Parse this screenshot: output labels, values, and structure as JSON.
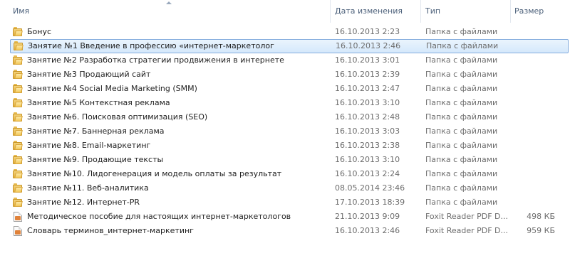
{
  "columns": {
    "name": "Имя",
    "date": "Дата изменения",
    "type": "Тип",
    "size": "Размер"
  },
  "colors": {
    "selection_border": "#84acdd",
    "selection_fill": "#d5e8fb",
    "header_text": "#4c607a"
  },
  "files": [
    {
      "icon": "folder-icon",
      "name": "Бонус",
      "date": "16.10.2013 2:23",
      "type": "Папка с файлами",
      "size": "",
      "selected": false
    },
    {
      "icon": "folder-icon",
      "name": "Занятие №1 Введение в профессию «интернет-маркетолог",
      "date": "16.10.2013 2:46",
      "type": "Папка с файлами",
      "size": "",
      "selected": true
    },
    {
      "icon": "folder-icon",
      "name": "Занятие №2 Разработка стратегии продвижения в интернете",
      "date": "16.10.2013 3:01",
      "type": "Папка с файлами",
      "size": "",
      "selected": false
    },
    {
      "icon": "folder-icon",
      "name": "Занятие №3 Продающий сайт",
      "date": "16.10.2013 2:39",
      "type": "Папка с файлами",
      "size": "",
      "selected": false
    },
    {
      "icon": "folder-icon",
      "name": "Занятие №4 Social Media Marketing (SMM)",
      "date": "16.10.2013 2:47",
      "type": "Папка с файлами",
      "size": "",
      "selected": false
    },
    {
      "icon": "folder-icon",
      "name": "Занятие №5 Контекстная реклама",
      "date": "16.10.2013 3:10",
      "type": "Папка с файлами",
      "size": "",
      "selected": false
    },
    {
      "icon": "folder-icon",
      "name": "Занятие №6. Поисковая оптимизация (SEO)",
      "date": "16.10.2013 2:48",
      "type": "Папка с файлами",
      "size": "",
      "selected": false
    },
    {
      "icon": "folder-icon",
      "name": "Занятие №7. Баннерная реклама",
      "date": "16.10.2013 3:03",
      "type": "Папка с файлами",
      "size": "",
      "selected": false
    },
    {
      "icon": "folder-icon",
      "name": "Занятие №8. Email-маркетинг",
      "date": "16.10.2013 2:38",
      "type": "Папка с файлами",
      "size": "",
      "selected": false
    },
    {
      "icon": "folder-icon",
      "name": "Занятие №9. Продающие тексты",
      "date": "16.10.2013 3:10",
      "type": "Папка с файлами",
      "size": "",
      "selected": false
    },
    {
      "icon": "folder-icon",
      "name": "Занятие №10. Лидогенерация и модель оплаты за результат",
      "date": "16.10.2013 2:24",
      "type": "Папка с файлами",
      "size": "",
      "selected": false
    },
    {
      "icon": "folder-icon",
      "name": "Занятие №11. Веб-аналитика",
      "date": "08.05.2014 23:46",
      "type": "Папка с файлами",
      "size": "",
      "selected": false
    },
    {
      "icon": "folder-icon",
      "name": "Занятие №12. Интернет-PR",
      "date": "17.10.2013 18:39",
      "type": "Папка с файлами",
      "size": "",
      "selected": false
    },
    {
      "icon": "pdf-file-icon",
      "name": "Методическое пособие для настоящих интернет-маркетологов",
      "date": "21.10.2013 9:09",
      "type": "Foxit Reader PDF D...",
      "size": "498 КБ",
      "selected": false
    },
    {
      "icon": "pdf-file-icon",
      "name": "Словарь терминов_интернет-маркетинг",
      "date": "16.10.2013 2:46",
      "type": "Foxit Reader PDF D...",
      "size": "959 КБ",
      "selected": false
    }
  ]
}
